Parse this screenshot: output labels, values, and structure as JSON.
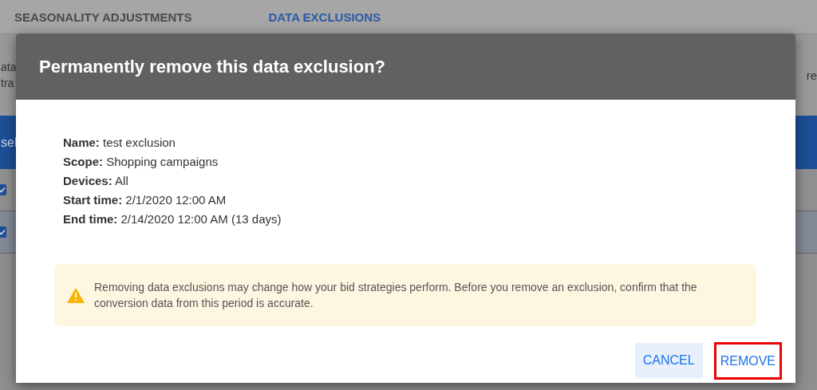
{
  "tabs": [
    {
      "label": "SEASONALITY ADJUSTMENTS",
      "selected": false
    },
    {
      "label": "DATA EXCLUSIONS",
      "selected": true
    }
  ],
  "background": {
    "left_text": [
      "ata",
      "tra"
    ],
    "right_text": "re",
    "table_header_text": "sel",
    "rows": [
      {
        "checked": true
      },
      {
        "checked": true
      }
    ]
  },
  "dialog": {
    "title": "Permanently remove this data exclusion?",
    "details": [
      "**Name:** test exclusion",
      "**Scope:** Shopping campaigns",
      "**Devices:** All",
      "**Start time:** 2/1/2020 12:00 AM",
      "**End time:** 2/14/2020 12:00 AM (13 days)"
    ],
    "warning": "Removing data exclusions may change how your bid strategies perform. Before you remove an exclusion, confirm that the conversion data from this period is accurate.",
    "buttons": [
      {
        "label": "CANCEL",
        "kind": "filled",
        "highlighted": false
      },
      {
        "label": "REMOVE",
        "kind": "text",
        "highlighted": true
      }
    ]
  }
}
